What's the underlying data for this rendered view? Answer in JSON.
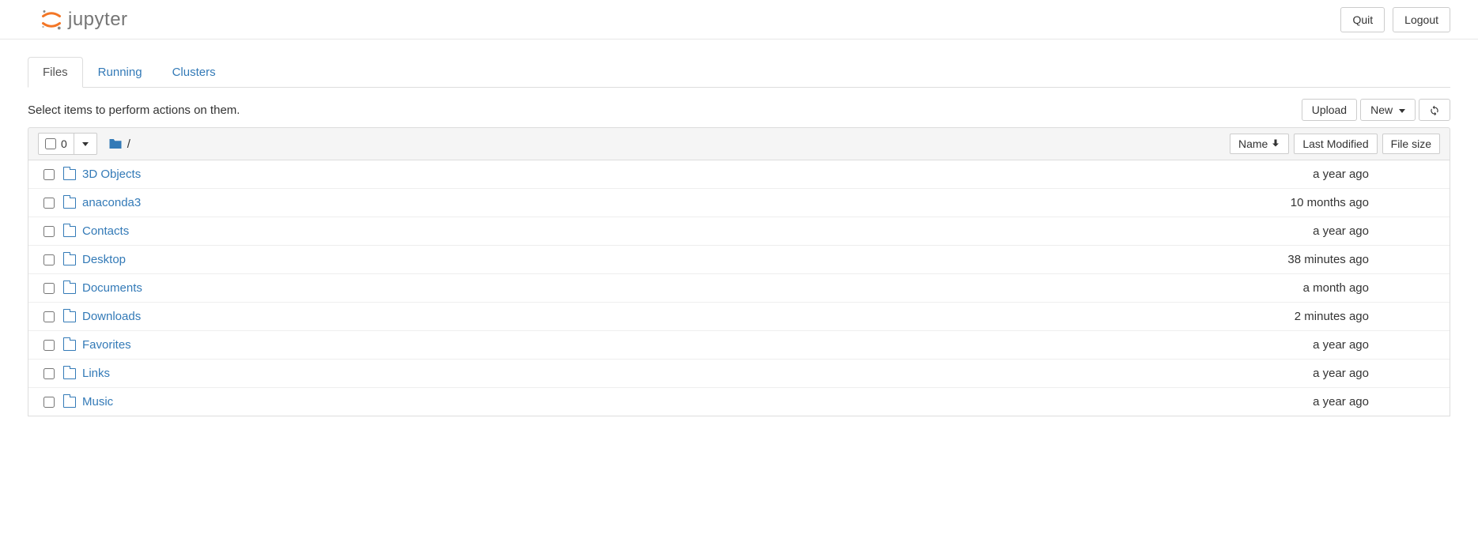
{
  "header": {
    "logo_text": "jupyter",
    "quit_label": "Quit",
    "logout_label": "Logout"
  },
  "tabs": {
    "items": [
      {
        "label": "Files",
        "active": true
      },
      {
        "label": "Running",
        "active": false
      },
      {
        "label": "Clusters",
        "active": false
      }
    ]
  },
  "toolbar": {
    "hint": "Select items to perform actions on them.",
    "upload_label": "Upload",
    "new_label": "New"
  },
  "list_header": {
    "selected_count": "0",
    "breadcrumb_sep": "/",
    "name_col": "Name",
    "modified_col": "Last Modified",
    "size_col": "File size"
  },
  "files": [
    {
      "name": "3D Objects",
      "modified": "a year ago",
      "size": ""
    },
    {
      "name": "anaconda3",
      "modified": "10 months ago",
      "size": ""
    },
    {
      "name": "Contacts",
      "modified": "a year ago",
      "size": ""
    },
    {
      "name": "Desktop",
      "modified": "38 minutes ago",
      "size": ""
    },
    {
      "name": "Documents",
      "modified": "a month ago",
      "size": ""
    },
    {
      "name": "Downloads",
      "modified": "2 minutes ago",
      "size": ""
    },
    {
      "name": "Favorites",
      "modified": "a year ago",
      "size": ""
    },
    {
      "name": "Links",
      "modified": "a year ago",
      "size": ""
    },
    {
      "name": "Music",
      "modified": "a year ago",
      "size": ""
    }
  ]
}
